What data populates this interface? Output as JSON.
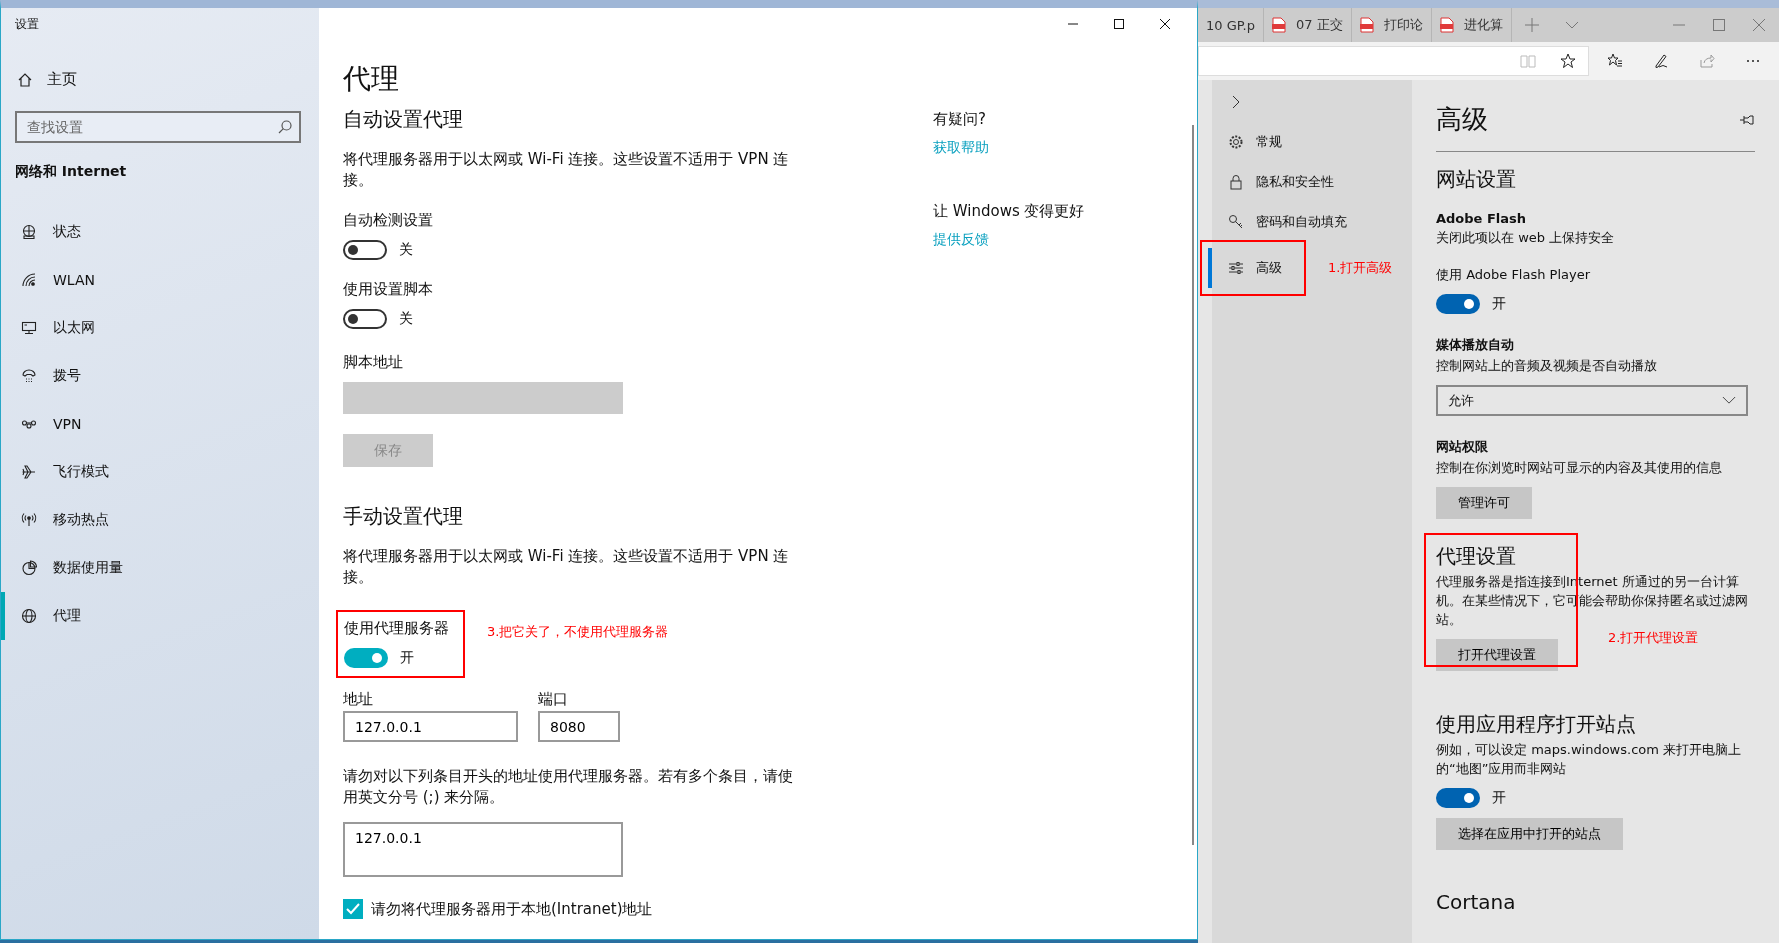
{
  "settings": {
    "title": "设置",
    "home": "主页",
    "search": {
      "placeholder": "查找设置"
    },
    "section": "网络和 Internet",
    "nav": [
      {
        "label": "状态",
        "selected": false
      },
      {
        "label": "WLAN",
        "selected": false
      },
      {
        "label": "以太网",
        "selected": false
      },
      {
        "label": "拨号",
        "selected": false
      },
      {
        "label": "VPN",
        "selected": false
      },
      {
        "label": "飞行模式",
        "selected": false
      },
      {
        "label": "移动热点",
        "selected": false
      },
      {
        "label": "数据使用量",
        "selected": false
      },
      {
        "label": "代理",
        "selected": true
      }
    ],
    "page_title": "代理",
    "auto_proxy": {
      "heading": "自动设置代理",
      "description": "将代理服务器用于以太网或 Wi-Fi 连接。这些设置不适用于 VPN 连接。",
      "toggles": [
        {
          "label": "自动检测设置",
          "on": false,
          "state_text": "关"
        },
        {
          "label": "使用设置脚本",
          "on": false,
          "state_text": "关"
        }
      ],
      "script_address": {
        "label": "脚本地址",
        "disabled": true
      },
      "save_button": {
        "label": "保存",
        "disabled": true
      }
    },
    "manual_proxy": {
      "heading": "手动设置代理",
      "description": "将代理服务器用于以太网或 Wi-Fi 连接。这些设置不适用于 VPN 连接。",
      "use_proxy": {
        "label": "使用代理服务器",
        "on": true,
        "state_text": "开"
      },
      "annotation": "3.把它关了，不使用代理服务器",
      "address": {
        "label": "地址",
        "value": "127.0.0.1"
      },
      "port": {
        "label": "端口",
        "value": "8080"
      },
      "exceptions_description": "请勿对以下列条目开头的地址使用代理服务器。若有多个条目，请使用英文分号 (;) 来分隔。",
      "exceptions": {
        "value": "127.0.0.1"
      },
      "bypass_local": {
        "label": "请勿将代理服务器用于本地(Intranet)地址",
        "checked": true
      }
    },
    "side": {
      "question": "有疑问?",
      "help_link": "获取帮助",
      "improve": "让 Windows 变得更好",
      "feedback_link": "提供反馈"
    }
  },
  "browser": {
    "tabs": [
      {
        "title": "10 GP.p",
        "pdf": false
      },
      {
        "title": "07 正交",
        "pdf": true
      },
      {
        "title": "打印论",
        "pdf": true
      },
      {
        "title": "进化算",
        "pdf": true
      }
    ],
    "nav": [
      {
        "label": "常规",
        "selected": false
      },
      {
        "label": "隐私和安全性",
        "selected": false
      },
      {
        "label": "密码和自动填充",
        "selected": false
      },
      {
        "label": "高级",
        "selected": true
      }
    ],
    "nav_annotation": "1.打开高级",
    "panel": {
      "title": "高级",
      "section": "网站设置",
      "flash": {
        "heading": "Adobe Flash",
        "description": "关闭此项以在 web 上保持安全",
        "toggle_label": "使用 Adobe Flash Player",
        "on": true,
        "state_text": "开"
      },
      "autoplay": {
        "heading": "媒体播放自动",
        "description": "控制网站上的音频及视频是否自动播放",
        "value": "允许"
      },
      "permissions": {
        "heading": "网站权限",
        "description": "控制在你浏览时网站可显示的内容及其使用的信息",
        "button": "管理许可"
      },
      "proxy": {
        "heading": "代理设置",
        "description": "代理服务器是指连接到Internet 所通过的另一台计算机。在某些情况下，它可能会帮助你保持匿名或过滤网站。",
        "button": "打开代理设置",
        "annotation": "2.打开代理设置"
      },
      "apps": {
        "heading": "使用应用程序打开站点",
        "description": "例如，可以设定 maps.windows.com 来打开电脑上的“地图”应用而非网站",
        "on": true,
        "state_text": "开",
        "button": "选择在应用中打开的站点"
      },
      "cortana": {
        "heading": "Cortana"
      }
    }
  }
}
